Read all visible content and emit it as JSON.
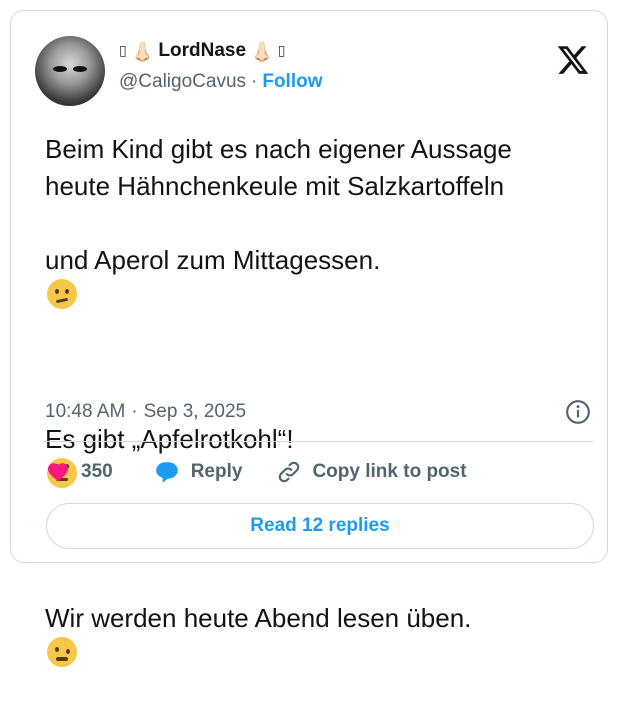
{
  "author": {
    "name": "LordNase",
    "name_prefix": "👃🏻",
    "name_suffix": "👃🏻",
    "missing_glyph": "▯",
    "handle": "@CaligoCavus",
    "separator": "·",
    "follow_label": "Follow"
  },
  "tweet": {
    "line1": "Beim Kind gibt es nach eigener Aussage",
    "line2": "heute Hähnchenkeule mit Salzkartoffeln",
    "line3": "und Aperol zum Mittagessen.",
    "line4": "Es gibt „Apfelrotkohl“!",
    "line5": "Wir werden heute Abend lesen üben.",
    "emoji1": "thinking-face",
    "emoji2": "face-with-rolling-eyes",
    "emoji3": "woozy-face"
  },
  "meta": {
    "time": "10:48 AM",
    "separator": "·",
    "date": "Sep 3, 2025"
  },
  "actions": {
    "likes": "350",
    "reply_label": "Reply",
    "copy_label": "Copy link to post"
  },
  "read_replies_label": "Read 12 replies",
  "colors": {
    "accent": "#1d9bf0",
    "like": "#f91880",
    "muted": "#536471",
    "border": "#cfd9de"
  }
}
